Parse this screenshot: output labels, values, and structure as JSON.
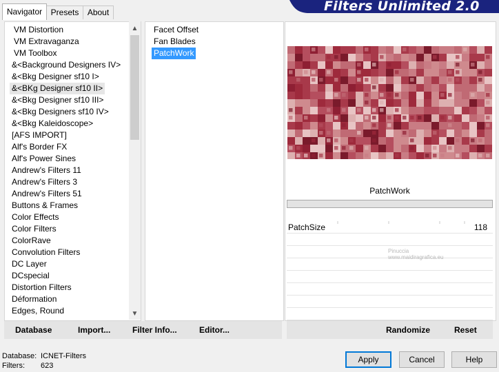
{
  "tabs": [
    {
      "label": "Navigator"
    },
    {
      "label": "Presets"
    },
    {
      "label": "About"
    }
  ],
  "banner": {
    "title": "Filters Unlimited 2.0"
  },
  "categories": [
    "VM Distortion",
    "VM Extravaganza",
    "VM Toolbox",
    "&<Background Designers IV>",
    "&<Bkg Designer sf10 I>",
    "&<BKg Designer sf10 II>",
    "&<Bkg Designer sf10 III>",
    "&<Bkg Designers sf10 IV>",
    "&<Bkg Kaleidoscope>",
    "[AFS IMPORT]",
    "Alf's Border FX",
    "Alf's Power Sines",
    "Andrew's Filters 11",
    "Andrew's Filters 3",
    "Andrew's Filters 51",
    "Buttons & Frames",
    "Color Effects",
    "Color Filters",
    "ColorRave",
    "Convolution Filters",
    "DC Layer",
    "DCspecial",
    "Distortion Filters",
    "Déformation",
    "Edges, Round"
  ],
  "selected_category_index": 5,
  "filters": [
    "Facet Offset",
    "Fan Blades",
    "PatchWork"
  ],
  "selected_filter_index": 2,
  "plugin": {
    "name": "PatchWork",
    "params": [
      {
        "name": "PatchSize",
        "value": "118"
      }
    ]
  },
  "watermark": {
    "line1": "Pinuccia",
    "line2": "www.maidiragrafica.eu"
  },
  "left_buttons": {
    "database": "Database",
    "import": "Import...",
    "filter_info": "Filter Info...",
    "editor": "Editor..."
  },
  "right_buttons": {
    "randomize": "Randomize",
    "reset": "Reset"
  },
  "status": {
    "database_label": "Database:",
    "database_value": "ICNET-Filters",
    "filters_label": "Filters:",
    "filters_value": "623"
  },
  "dialog": {
    "apply": "Apply",
    "cancel": "Cancel",
    "help": "Help"
  },
  "colors": {
    "selection": "#3399ff",
    "default_button_border": "#0078d7",
    "banner": "#1a237e",
    "preview_dark": "#9e2a3c",
    "preview_light": "#e8c4c4"
  }
}
